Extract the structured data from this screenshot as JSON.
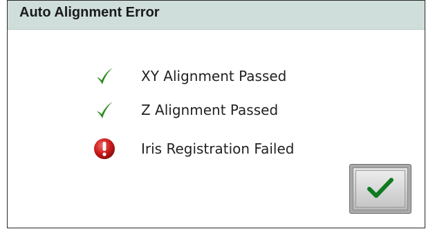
{
  "dialog": {
    "title": "Auto Alignment Error",
    "status_items": [
      {
        "label": "XY Alignment Passed",
        "status": "passed",
        "icon": "check-icon"
      },
      {
        "label": "Z Alignment Passed",
        "status": "passed",
        "icon": "check-icon"
      },
      {
        "label": "Iris Registration Failed",
        "status": "failed",
        "icon": "error-icon"
      }
    ],
    "ok_button": {
      "icon": "check-icon"
    }
  },
  "colors": {
    "title_bar": "#cfdedb",
    "check_green": "#2e8b1f",
    "error_red": "#cc1b1b"
  }
}
